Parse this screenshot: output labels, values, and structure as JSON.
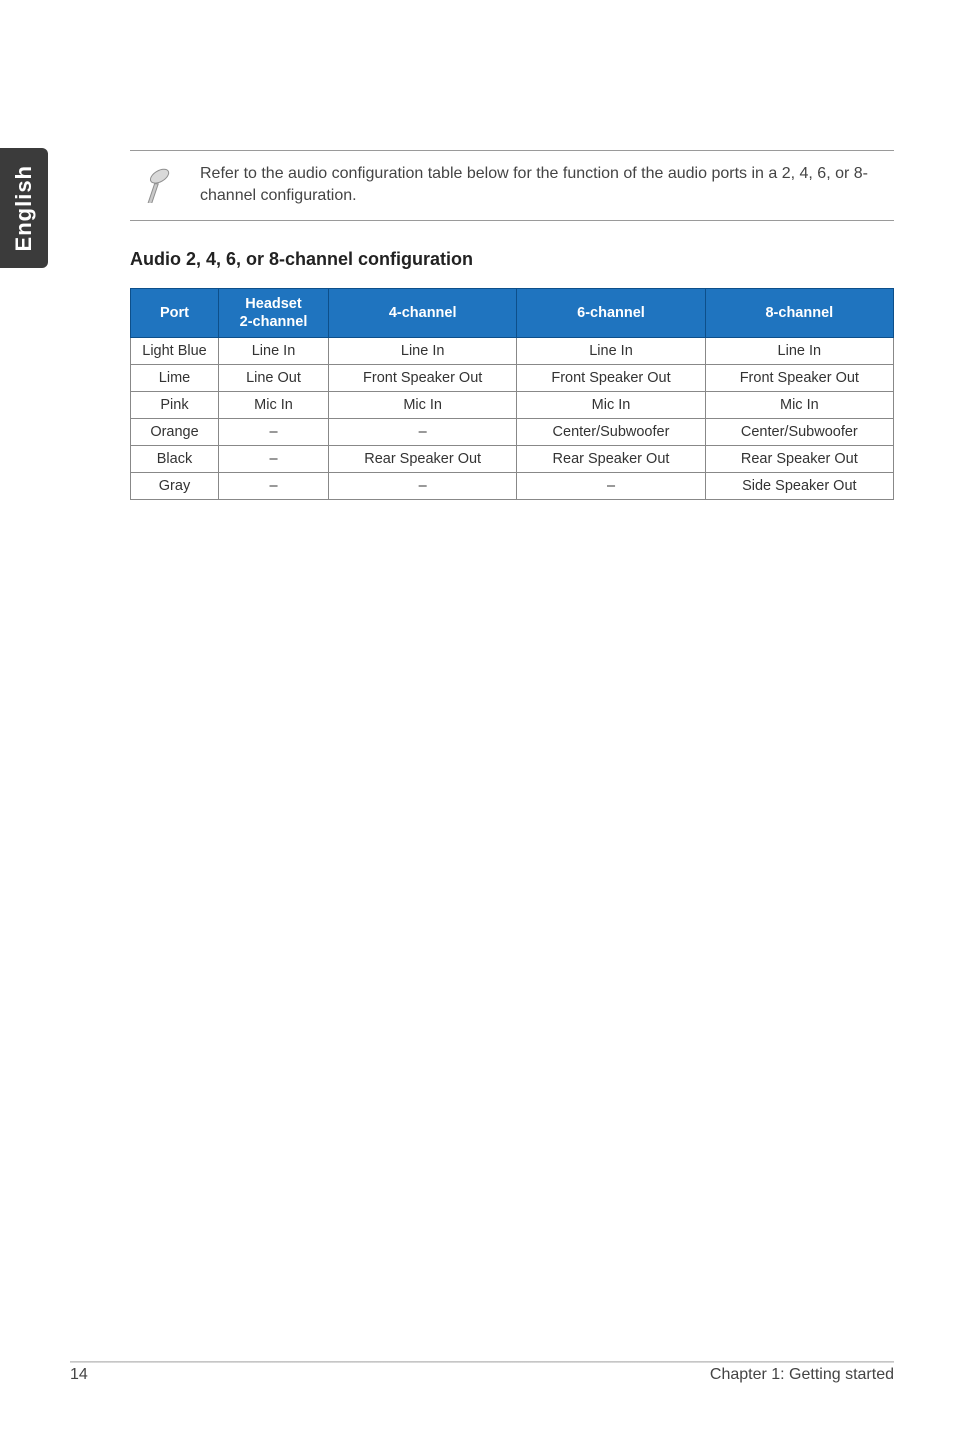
{
  "sidebar": {
    "language": "English"
  },
  "note": {
    "text": "Refer to the audio configuration table below for the function of the audio ports in a 2, 4, 6, or 8-channel configuration."
  },
  "section": {
    "title": "Audio 2, 4, 6, or 8-channel configuration"
  },
  "table": {
    "headers": {
      "port": "Port",
      "headset": "Headset\n2-channel",
      "ch4": "4-channel",
      "ch6": "6-channel",
      "ch8": "8-channel"
    },
    "rows": [
      {
        "port": "Light Blue",
        "hs": "Line In",
        "c4": "Line In",
        "c6": "Line In",
        "c8": "Line In"
      },
      {
        "port": "Lime",
        "hs": "Line Out",
        "c4": "Front Speaker Out",
        "c6": "Front Speaker Out",
        "c8": "Front Speaker Out"
      },
      {
        "port": "Pink",
        "hs": "Mic In",
        "c4": "Mic In",
        "c6": "Mic In",
        "c8": "Mic In"
      },
      {
        "port": "Orange",
        "hs": "–",
        "c4": "–",
        "c6": "Center/Subwoofer",
        "c8": "Center/Subwoofer"
      },
      {
        "port": "Black",
        "hs": "–",
        "c4": "Rear Speaker Out",
        "c6": "Rear Speaker Out",
        "c8": "Rear Speaker Out"
      },
      {
        "port": "Gray",
        "hs": "–",
        "c4": "–",
        "c6": "–",
        "c8": "Side Speaker Out"
      }
    ]
  },
  "footer": {
    "page": "14",
    "chapter": "Chapter 1: Getting started"
  }
}
